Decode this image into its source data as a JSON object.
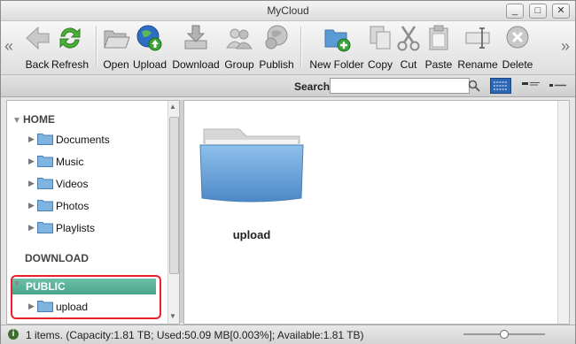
{
  "window": {
    "title": "MyCloud",
    "minimize_glyph": "_",
    "maximize_glyph": "□",
    "close_glyph": "✕"
  },
  "toolbar": {
    "left_scroll_glyph": "«",
    "right_scroll_glyph": "»",
    "buttons": [
      {
        "label": "Back",
        "icon": "back-arrow-icon"
      },
      {
        "label": "Refresh",
        "icon": "refresh-icon"
      },
      {
        "label": "Open",
        "icon": "open-folder-icon"
      },
      {
        "label": "Upload",
        "icon": "upload-globe-icon"
      },
      {
        "label": "Download",
        "icon": "download-icon"
      },
      {
        "label": "Group",
        "icon": "group-icon"
      },
      {
        "label": "Publish",
        "icon": "publish-icon"
      },
      {
        "label": "New Folder",
        "icon": "new-folder-icon"
      },
      {
        "label": "Copy",
        "icon": "copy-icon"
      },
      {
        "label": "Cut",
        "icon": "scissors-icon"
      },
      {
        "label": "Paste",
        "icon": "paste-icon"
      },
      {
        "label": "Rename",
        "icon": "rename-icon"
      },
      {
        "label": "Delete",
        "icon": "delete-icon"
      }
    ]
  },
  "search": {
    "label": "Search",
    "value": "",
    "placeholder": ""
  },
  "sidebar": {
    "home_label": "HOME",
    "home_items": [
      "Documents",
      "Music",
      "Videos",
      "Photos",
      "Playlists"
    ],
    "download_label": "DOWNLOAD",
    "public_label": "PUBLIC",
    "public_items": [
      "upload"
    ]
  },
  "main": {
    "items": [
      {
        "name": "upload",
        "type": "folder"
      }
    ]
  },
  "status": {
    "text": "1 items. (Capacity:1.81 TB; Used:50.09 MB[0.003%]; Available:1.81 TB)",
    "zoom_fraction": 0.5
  },
  "colors": {
    "accent_selected": "#4aa58b",
    "highlight_outline": "#e8212b",
    "folder_blue": "#5b9bd5"
  }
}
